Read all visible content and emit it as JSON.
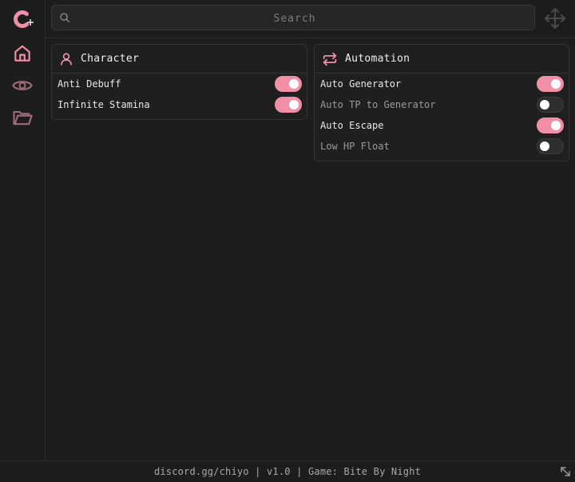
{
  "search": {
    "placeholder": "Search"
  },
  "sidebar": {
    "items": [
      {
        "name": "home",
        "icon": "home-icon",
        "active": true
      },
      {
        "name": "visuals",
        "icon": "eye-icon",
        "active": false
      },
      {
        "name": "files",
        "icon": "folder-icon",
        "active": false
      }
    ]
  },
  "panels": {
    "character": {
      "title": "Character",
      "icon": "user-icon",
      "rows": [
        {
          "label": "Anti Debuff",
          "enabled": true
        },
        {
          "label": "Infinite Stamina",
          "enabled": true
        }
      ]
    },
    "automation": {
      "title": "Automation",
      "icon": "repeat-icon",
      "rows": [
        {
          "label": "Auto Generator",
          "enabled": true
        },
        {
          "label": "Auto TP to Generator",
          "enabled": false
        },
        {
          "label": "Auto Escape",
          "enabled": true
        },
        {
          "label": "Low HP Float",
          "enabled": false
        }
      ]
    }
  },
  "footer": {
    "text": "discord.gg/chiyo | v1.0 | Game: Bite By Night"
  },
  "colors": {
    "accent": "#f08fa6",
    "background": "#1d1d1d",
    "panel": "#1f1f1f",
    "border": "#333333"
  }
}
